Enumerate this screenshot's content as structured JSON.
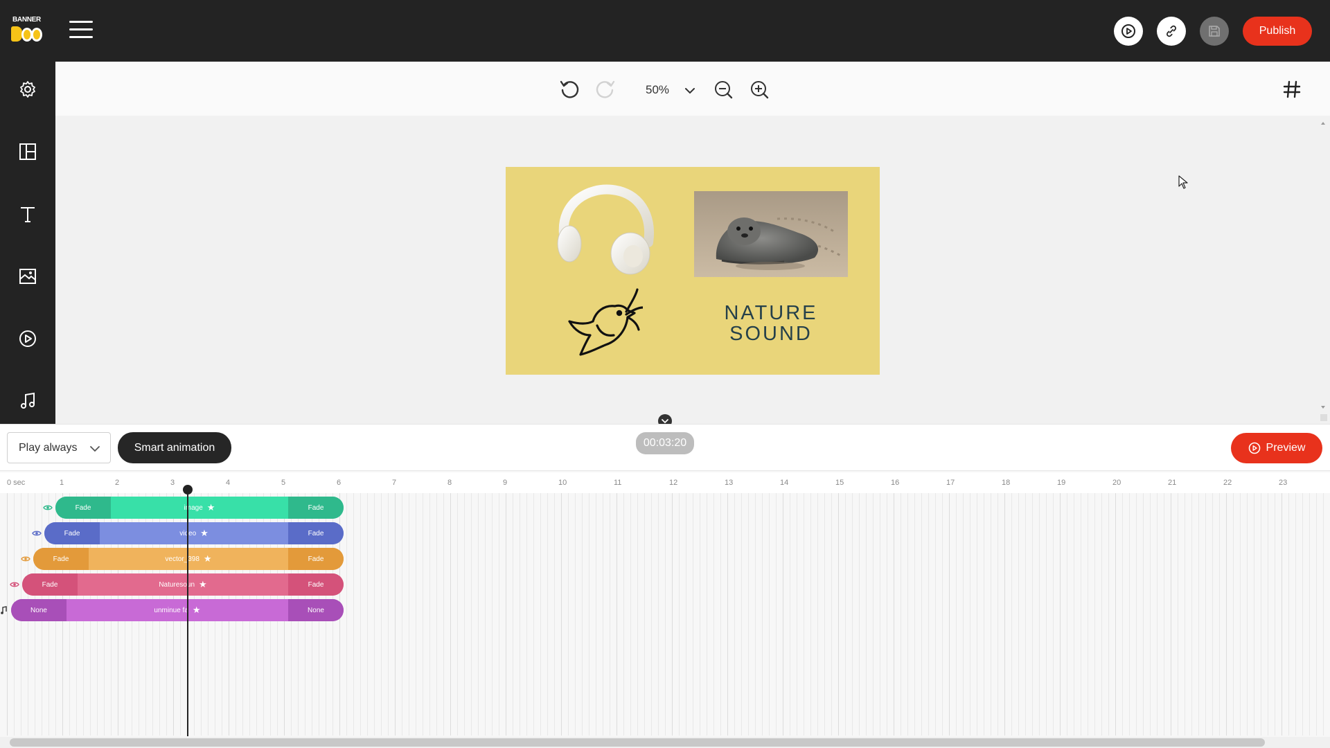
{
  "app": {
    "logo_text": "BANNER BOO"
  },
  "topbar": {
    "publish_label": "Publish",
    "icons": [
      "play-circle-icon",
      "link-icon",
      "save-icon"
    ]
  },
  "sidebar": {
    "items": [
      "settings-icon",
      "layout-icon",
      "text-icon",
      "image-icon",
      "video-icon",
      "music-icon"
    ]
  },
  "toolbar": {
    "zoom_value": "50%"
  },
  "canvas": {
    "banner_title_line1": "NATURE",
    "banner_title_line2": "SOUND",
    "banner_bg": "#e9d57a"
  },
  "timeline": {
    "play_mode": "Play always",
    "smart_animation_label": "Smart animation",
    "current_time": "00:03:20",
    "preview_label": "Preview",
    "ruler_labels": [
      "0 sec",
      "1",
      "2",
      "3",
      "4",
      "5",
      "6",
      "7",
      "8",
      "9",
      "10",
      "11",
      "12",
      "13",
      "14",
      "15",
      "16",
      "17",
      "18",
      "19",
      "20",
      "21",
      "22",
      "23"
    ],
    "tracks": [
      {
        "name": "image",
        "in": "Fade",
        "out": "Fade",
        "color": "#38e0a8",
        "edge": "#2fb98c"
      },
      {
        "name": "video",
        "in": "Fade",
        "out": "Fade",
        "color": "#7c8ee0",
        "edge": "#5a6cc8"
      },
      {
        "name": "vector_398",
        "in": "Fade",
        "out": "Fade",
        "color": "#f0b35c",
        "edge": "#e39a3a"
      },
      {
        "name": "Naturesoun",
        "in": "Fade",
        "out": "Fade",
        "color": "#e26a8e",
        "edge": "#d4527a"
      },
      {
        "name": "unminue fa",
        "in": "None",
        "out": "None",
        "color": "#c86ad6",
        "edge": "#a84fb8"
      }
    ]
  }
}
